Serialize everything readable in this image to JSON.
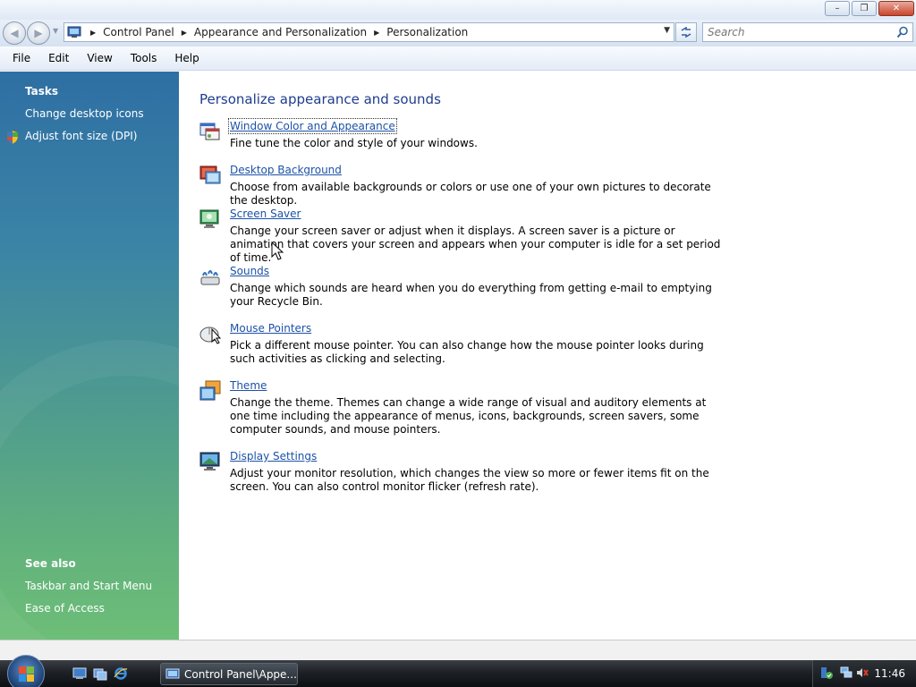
{
  "window": {
    "minimize_glyph": "–",
    "restore_glyph": "❐",
    "close_glyph": "✕"
  },
  "address": {
    "crumbs": [
      "Control Panel",
      "Appearance and Personalization",
      "Personalization"
    ]
  },
  "search": {
    "placeholder": "Search"
  },
  "menu": {
    "items": [
      "File",
      "Edit",
      "View",
      "Tools",
      "Help"
    ]
  },
  "sidebar": {
    "tasks_heading": "Tasks",
    "tasks": [
      "Change desktop icons",
      "Adjust font size (DPI)"
    ],
    "see_also_heading": "See also",
    "see_also": [
      "Taskbar and Start Menu",
      "Ease of Access"
    ]
  },
  "main": {
    "title": "Personalize appearance and sounds",
    "items": [
      {
        "label": "Window Color and Appearance",
        "icon": "window-color-icon",
        "desc": "Fine tune the color and style of your windows."
      },
      {
        "label": "Desktop Background",
        "icon": "desktop-background-icon",
        "desc": "Choose from available backgrounds or colors or use one of your own pictures to decorate the desktop."
      },
      {
        "label": "Screen Saver",
        "icon": "screen-saver-icon",
        "desc": "Change your screen saver or adjust when it displays. A screen saver is a picture or animation that covers your screen and appears when your computer is idle for a set period of time."
      },
      {
        "label": "Sounds",
        "icon": "sounds-icon",
        "desc": "Change which sounds are heard when you do everything from getting e-mail to emptying your Recycle Bin."
      },
      {
        "label": "Mouse Pointers",
        "icon": "mouse-icon",
        "desc": "Pick a different mouse pointer. You can also change how the mouse pointer looks during such activities as clicking and selecting."
      },
      {
        "label": "Theme",
        "icon": "theme-icon",
        "desc": "Change the theme. Themes can change a wide range of visual and auditory elements at one time including the appearance of menus, icons, backgrounds, screen savers, some computer sounds, and mouse pointers."
      },
      {
        "label": "Display Settings",
        "icon": "display-icon",
        "desc": "Adjust your monitor resolution, which changes the view so more or fewer items fit on the screen. You can also control monitor flicker (refresh rate)."
      }
    ]
  },
  "taskbar": {
    "window_button": "Control Panel\\Appe...",
    "clock": "11:46"
  },
  "colors": {
    "link": "#1c52a8",
    "title": "#1e3d8f",
    "sidebar_top": "#2e6fa3",
    "sidebar_bottom": "#6dbe78"
  }
}
